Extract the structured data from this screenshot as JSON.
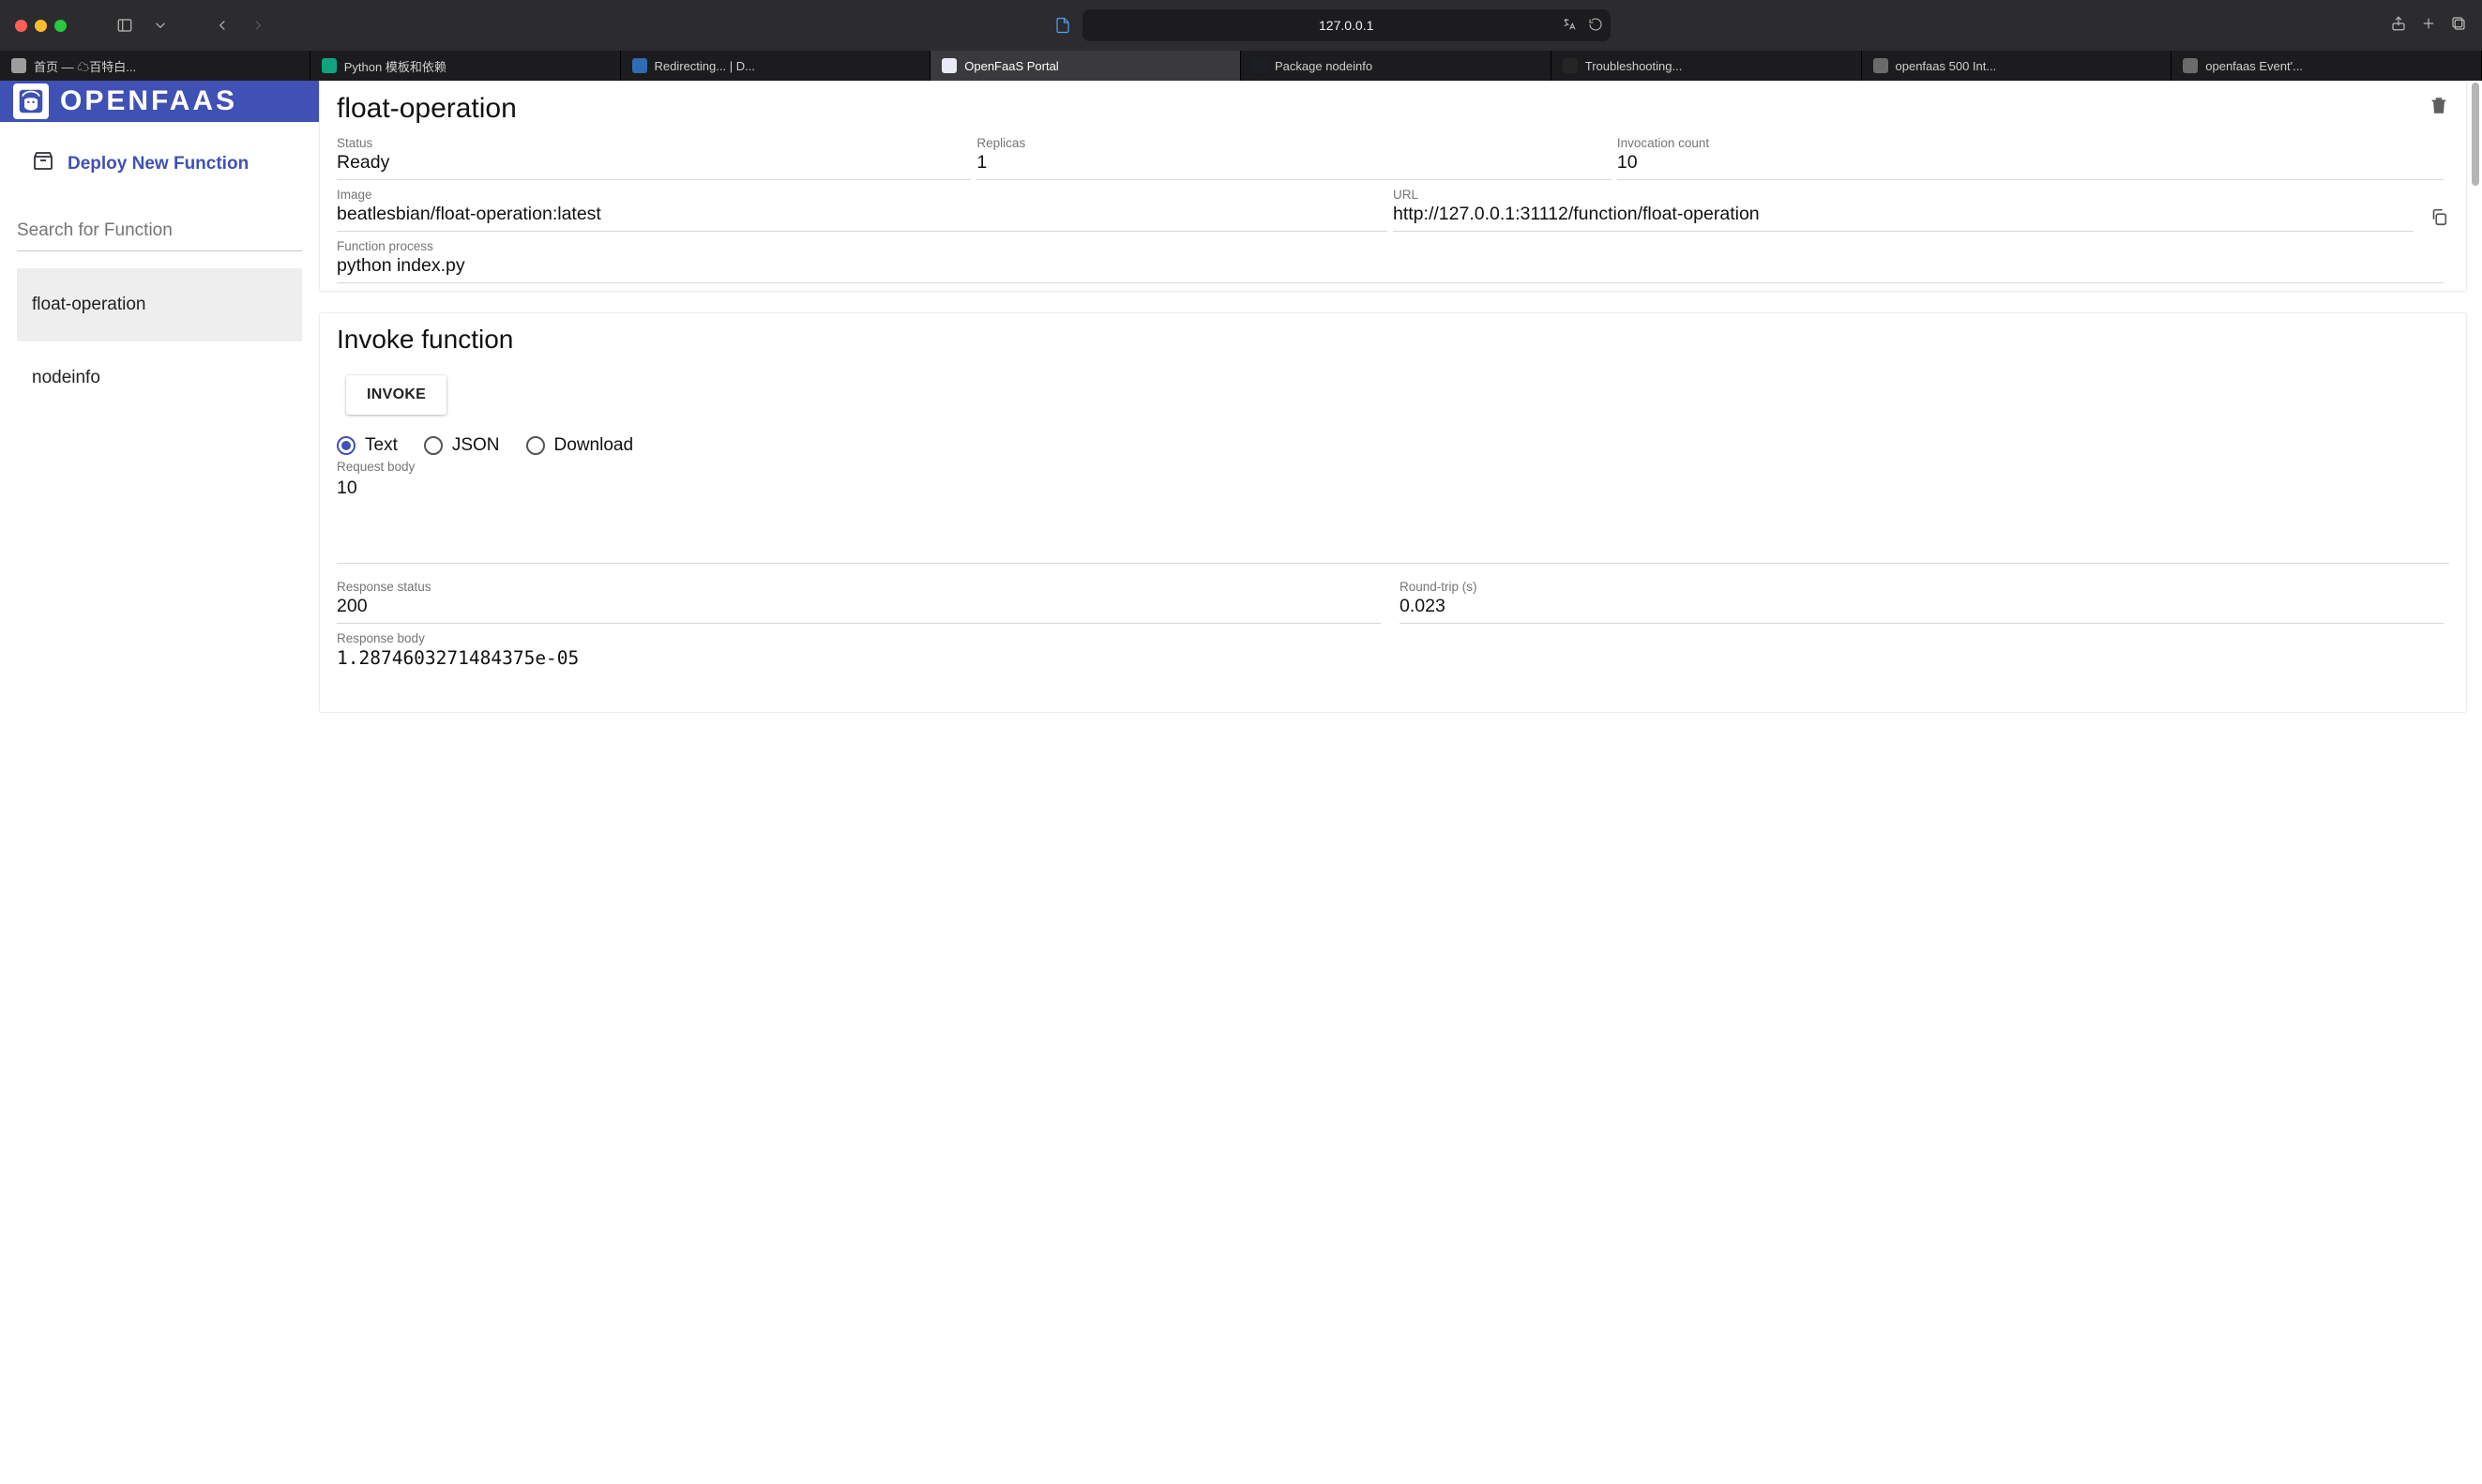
{
  "browser": {
    "address": "127.0.0.1",
    "tabs": [
      {
        "label": "首页 — ☁百特白...",
        "favicon_bg": "#9d9d9d"
      },
      {
        "label": "Python 模板和依赖",
        "favicon_bg": "#10a37f"
      },
      {
        "label": "Redirecting... | D...",
        "favicon_bg": "#2e6db4"
      },
      {
        "label": "OpenFaaS Portal",
        "favicon_bg": "#e9eaf5"
      },
      {
        "label": "Package nodeinfo",
        "favicon_bg": "#1b1f23"
      },
      {
        "label": "Troubleshooting...",
        "favicon_bg": "#252525"
      },
      {
        "label": "openfaas 500 Int...",
        "favicon_bg": "#6b6b6b"
      },
      {
        "label": "openfaas Event'...",
        "favicon_bg": "#6b6b6b"
      }
    ],
    "active_tab_index": 3
  },
  "sidebar": {
    "brand": "OPENFAAS",
    "deploy_label": "Deploy New Function",
    "search_placeholder": "Search for Function",
    "items": [
      {
        "name": "float-operation"
      },
      {
        "name": "nodeinfo"
      }
    ],
    "selected_index": 0
  },
  "fn": {
    "title": "float-operation",
    "status_label": "Status",
    "status_value": "Ready",
    "replicas_label": "Replicas",
    "replicas_value": "1",
    "invocations_label": "Invocation count",
    "invocations_value": "10",
    "image_label": "Image",
    "image_value": "beatlesbian/float-operation:latest",
    "url_label": "URL",
    "url_value": "http://127.0.0.1:31112/function/float-operation",
    "process_label": "Function process",
    "process_value": "python index.py"
  },
  "invoke": {
    "title": "Invoke function",
    "button_label": "INVOKE",
    "radios": {
      "text": "Text",
      "json": "JSON",
      "download": "Download"
    },
    "selected_radio": "text",
    "request_body_label": "Request body",
    "request_body_value": "10",
    "response_status_label": "Response status",
    "response_status_value": "200",
    "round_trip_label": "Round-trip (s)",
    "round_trip_value": "0.023",
    "response_body_label": "Response body",
    "response_body_value": "1.2874603271484375e-05"
  }
}
